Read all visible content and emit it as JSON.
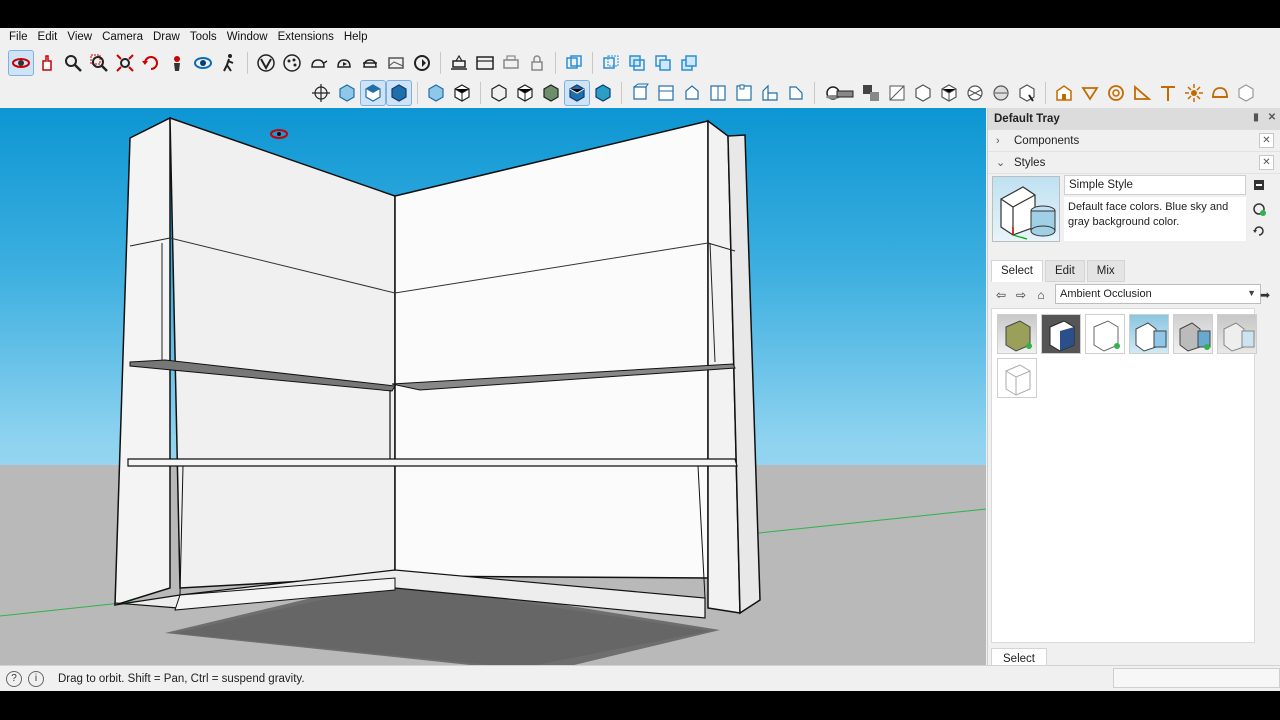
{
  "menu": [
    "File",
    "Edit",
    "View",
    "Camera",
    "Draw",
    "Tools",
    "Window",
    "Extensions",
    "Help"
  ],
  "toolbar1": [
    "orbit-icon",
    "pan-icon",
    "zoom-icon",
    "zoom-window-icon",
    "zoom-extents-icon",
    "previous-view-icon",
    "position-camera-icon",
    "look-around-icon",
    "walk-icon",
    "vcb-icon",
    "style-palette-icon",
    "teapot-icon",
    "teapot-arrow-icon",
    "section-icon",
    "rectangle-frame-icon",
    "rotate-icon",
    "print-icon",
    "window-icon",
    "printer-icon",
    "lock-icon",
    "group1-icon",
    "group2-icon",
    "group3-icon",
    "group4-icon",
    "group5-icon"
  ],
  "toolbar2": [
    "axes-icon",
    "iso-icon",
    "top-icon",
    "front-icon",
    "right-icon",
    "back-icon",
    "left-icon",
    "wireframe-icon",
    "hidden-line-icon",
    "shaded-icon",
    "textured-icon",
    "monochrome-icon",
    "xray-icon",
    "face-icon",
    "style2-icon",
    "style3-icon",
    "style4-icon",
    "style5-icon",
    "style6-icon"
  ],
  "tray": {
    "title": "Default Tray",
    "components_label": "Components",
    "styles_label": "Styles",
    "style_name": "Simple Style",
    "style_description": "Default face colors. Blue sky and gray background color.",
    "tabs": [
      "Select",
      "Edit",
      "Mix"
    ],
    "active_tab": "Select",
    "collection": "Ambient Occlusion",
    "bottom_tab": "Select"
  },
  "status": {
    "message": "Drag to orbit. Shift = Pan, Ctrl = suspend gravity."
  },
  "colors": {
    "sky_top": "#0c96d3",
    "ground": "#b9b9b9",
    "axis_green": "#2fb34a"
  }
}
